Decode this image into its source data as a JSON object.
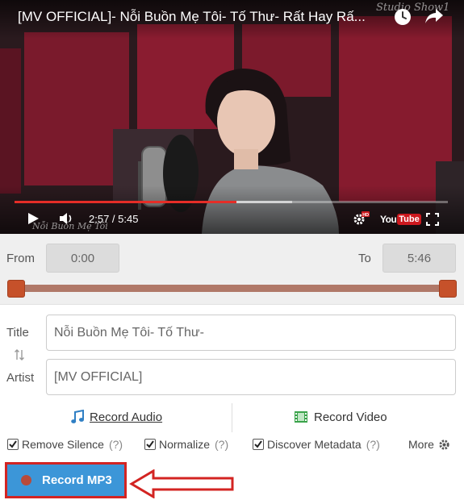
{
  "player": {
    "video_title": "[MV OFFICIAL]- Nỗi Buồn Mẹ Tôi- Tố Thư- Rất Hay Rấ...",
    "watermark_top": "Studio Show1",
    "watermark_bottom": "Nỗi Buồn Mẹ Tôi",
    "time_display": "2:57 / 5:45",
    "progress_played_fraction": 0.513,
    "progress_buffered_fraction": 0.64,
    "logo_you": "You",
    "logo_tube": "Tube",
    "hd_badge": "HD",
    "accent_color": "#e52d27"
  },
  "range": {
    "from_label": "From",
    "from_value": "0:00",
    "to_label": "To",
    "to_value": "5:46",
    "start_fraction": 0.0,
    "end_fraction": 1.0
  },
  "metadata": {
    "title_label": "Title",
    "title_value": "Nỗi Buồn Mẹ Tôi- Tố Thư-",
    "artist_label": "Artist",
    "artist_value": "[MV OFFICIAL]",
    "swap_icon": "swap-vertical-icon"
  },
  "modes": {
    "record_audio_label": "Record Audio",
    "record_audio_icon": "music-note-icon",
    "record_video_label": "Record Video",
    "record_video_icon": "film-icon"
  },
  "options": {
    "remove_silence_label": "Remove Silence",
    "remove_silence_checked": true,
    "normalize_label": "Normalize",
    "normalize_checked": true,
    "discover_metadata_label": "Discover Metadata",
    "discover_metadata_checked": true,
    "help_text": "(?)",
    "more_label": "More"
  },
  "record_button": {
    "label": "Record MP3",
    "color": "#3c96d8",
    "highlight_color": "#d32422"
  }
}
